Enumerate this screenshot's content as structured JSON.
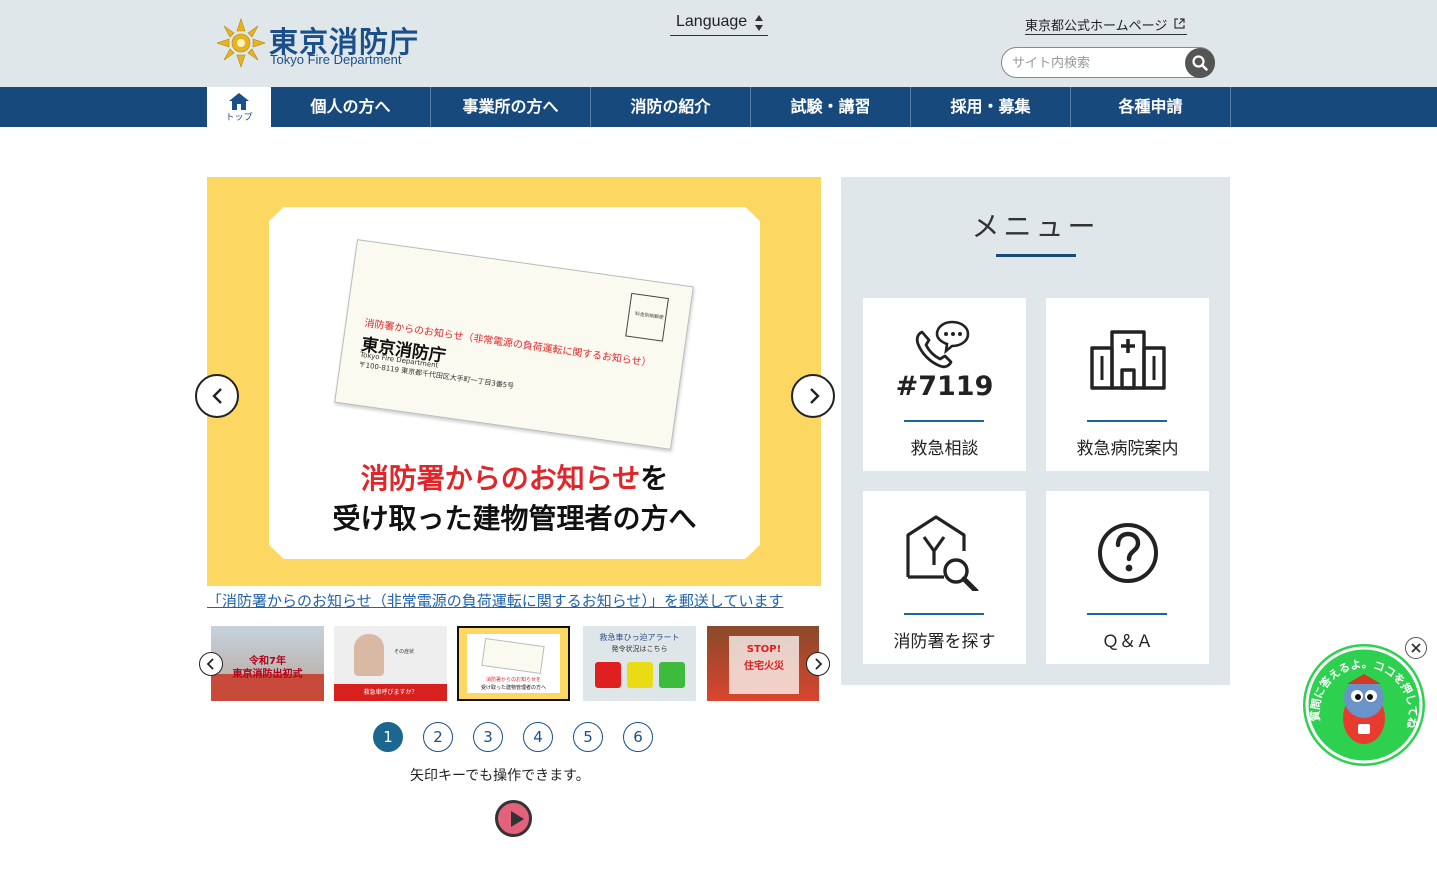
{
  "header": {
    "logo_ja": "東京消防庁",
    "logo_en": "Tokyo Fire Department",
    "language_label": "Language",
    "gov_link": "東京都公式ホームページ",
    "search_placeholder": "サイト内検索"
  },
  "nav": {
    "home_label": "トップ",
    "items": [
      "個人の方へ",
      "事業所の方へ",
      "消防の紹介",
      "試験・講習",
      "採用・募集",
      "各種申請"
    ]
  },
  "slider": {
    "envelope_notice": "消防署からのお知らせ（非常電源の負荷運転に関するお知らせ）",
    "envelope_name": "東京消防庁",
    "envelope_en": "Tokyo Fire Department",
    "envelope_address": "〒100-8119 東京都千代田区大手町一丁目3番5号",
    "envelope_stamp": "料金別納郵便",
    "headline_red": "消防署からのお知らせ",
    "headline_black": "を",
    "headline_line2": "受け取った建物管理者の方へ",
    "caption": "「消防署からのお知らせ（非常電源の負荷運転に関するお知らせ）」を郵送しています",
    "thumbs": [
      {
        "text1": "令和7年",
        "text2": "東京消防出初式"
      },
      {
        "text1": "その症状",
        "text2": "救急車呼びますか？"
      },
      {
        "text1": "消防署からのお知らせを",
        "text2": "受け取った建物管理者の方へ"
      },
      {
        "text1": "救急車ひっ迫アラート",
        "text2": "発令状況はこちら"
      },
      {
        "text1": "STOP!",
        "text2": "住宅火災"
      }
    ],
    "pages": [
      "1",
      "2",
      "3",
      "4",
      "5",
      "6"
    ],
    "active_page": 1,
    "hint": "矢印キーでも操作できます。"
  },
  "menu": {
    "title": "メニュー",
    "tiles": [
      {
        "label": "救急相談",
        "number": "#7119",
        "icon": "phone-chat-icon"
      },
      {
        "label": "救急病院案内",
        "icon": "hospital-icon"
      },
      {
        "label": "消防署を探す",
        "icon": "house-search-icon"
      },
      {
        "label": "Ｑ＆Ａ",
        "icon": "question-icon"
      }
    ]
  },
  "mascot": {
    "text": "質問に答えるよ。ココを押してね！",
    "icon": "mascot-icon"
  },
  "colors": {
    "nav_bg": "#17497c",
    "header_bg": "#e0e7ea",
    "slider_bg": "#fcd863",
    "link": "#1f63ad",
    "accent_red": "#e0262b"
  }
}
